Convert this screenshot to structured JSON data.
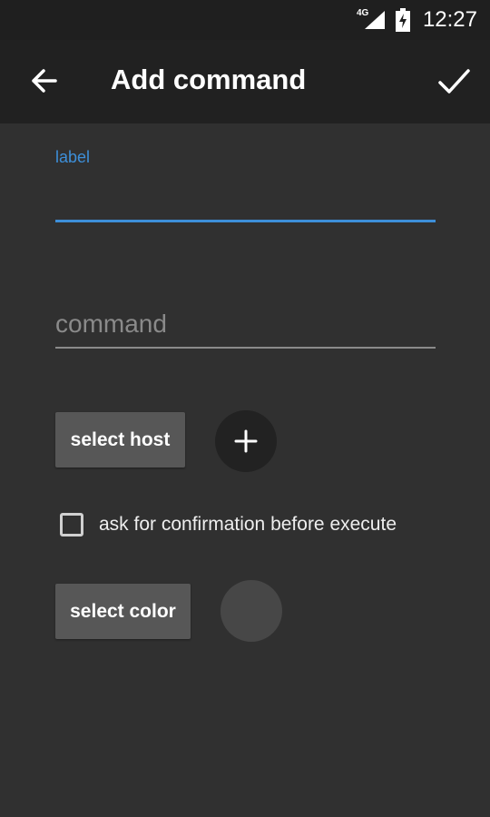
{
  "status_bar": {
    "network": "4G",
    "time": "12:27"
  },
  "app_bar": {
    "back_icon": "arrow-back-icon",
    "title": "Add command",
    "confirm_icon": "check-icon"
  },
  "form": {
    "label_field": {
      "caption": "label",
      "value": "",
      "accent_color": "#3d8fd9"
    },
    "command_field": {
      "placeholder": "command",
      "value": ""
    },
    "select_host_label": "select host",
    "add_host_icon": "plus-icon",
    "confirmation_checkbox": {
      "label": "ask for confirmation before execute",
      "checked": false
    },
    "select_color_label": "select color",
    "selected_color": "#474747"
  }
}
